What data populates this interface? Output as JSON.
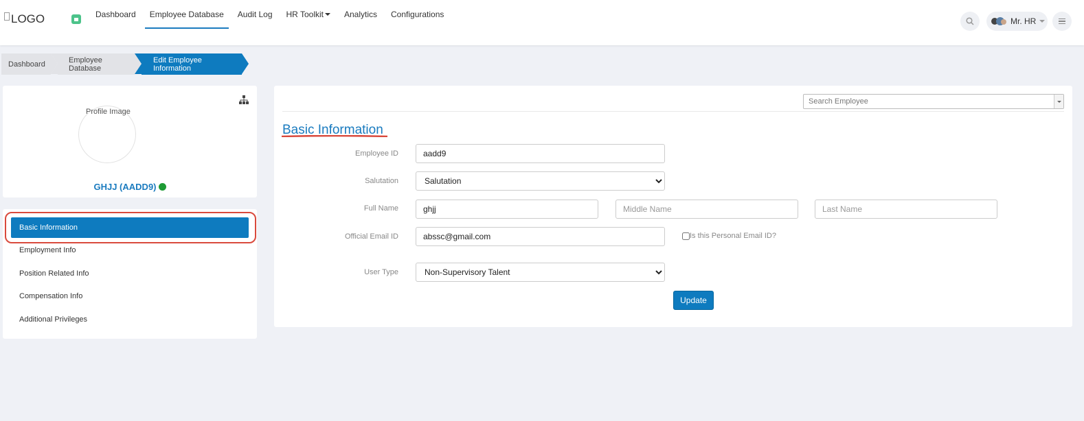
{
  "nav": {
    "logo_alt": "LOGO",
    "items": [
      {
        "label": "Dashboard"
      },
      {
        "label": "Employee Database"
      },
      {
        "label": "Audit Log"
      },
      {
        "label": "HR Toolkit"
      },
      {
        "label": "Analytics"
      },
      {
        "label": "Configurations"
      }
    ],
    "user_name": "Mr. HR"
  },
  "breadcrumb": [
    "Dashboard",
    "Employee Database",
    "Edit Employee Information"
  ],
  "profile": {
    "img_alt": "Profile Image",
    "name": "GHJJ (AADD9)",
    "status_color": "#1e9b35"
  },
  "side_menu": [
    "Basic Information",
    "Employment Info",
    "Position Related Info",
    "Compensation Info",
    "Additional Privileges"
  ],
  "search_employee": {
    "placeholder": "Search Employee"
  },
  "section_title": "Basic Information",
  "form": {
    "employee_id": {
      "label": "Employee ID",
      "value": "aadd9"
    },
    "salutation": {
      "label": "Salutation",
      "value": "Salutation"
    },
    "full_name": {
      "label": "Full Name",
      "first": "ghjj",
      "middle_placeholder": "Middle Name",
      "last_placeholder": "Last Name"
    },
    "email": {
      "label": "Official Email ID",
      "value": "abssc@gmail.com",
      "checkbox_label": "Is this Personal Email ID?"
    },
    "user_type": {
      "label": "User Type",
      "value": "Non-Supervisory Talent"
    },
    "update_label": "Update"
  },
  "colors": {
    "accent": "#0e7bbf",
    "highlight": "#d9493c"
  }
}
